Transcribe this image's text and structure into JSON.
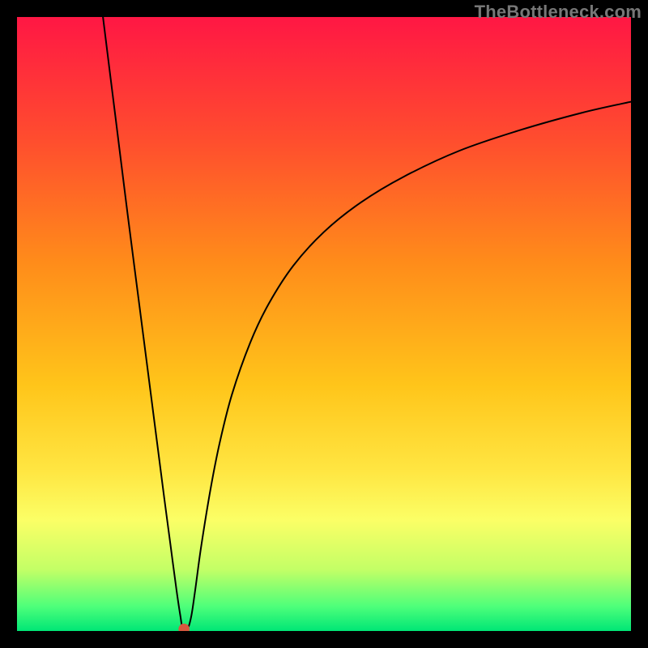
{
  "watermark": "TheBottleneck.com",
  "chart_data": {
    "type": "line",
    "title": "",
    "xlabel": "",
    "ylabel": "",
    "xlim": [
      0,
      100
    ],
    "ylim": [
      0,
      100
    ],
    "grid": false,
    "legend": false,
    "background_gradient_stops": [
      {
        "offset": 0.0,
        "color": "#ff1744"
      },
      {
        "offset": 0.2,
        "color": "#ff4d2e"
      },
      {
        "offset": 0.4,
        "color": "#ff8c1a"
      },
      {
        "offset": 0.6,
        "color": "#ffc51a"
      },
      {
        "offset": 0.74,
        "color": "#ffe642"
      },
      {
        "offset": 0.82,
        "color": "#fbff66"
      },
      {
        "offset": 0.9,
        "color": "#c3ff66"
      },
      {
        "offset": 0.96,
        "color": "#4eff7a"
      },
      {
        "offset": 1.0,
        "color": "#00e676"
      }
    ],
    "marker": {
      "x": 27.2,
      "y": 0.3,
      "color": "#d8583f",
      "radius": 0.9
    },
    "series": [
      {
        "name": "curve",
        "x": [
          14.0,
          16.0,
          18.0,
          20.0,
          22.0,
          24.0,
          25.0,
          26.0,
          26.6,
          27.0,
          27.8,
          28.4,
          29.0,
          30.0,
          31.5,
          33.0,
          35.0,
          38.0,
          41.0,
          45.0,
          50.0,
          56.0,
          63.0,
          72.0,
          82.0,
          92.0,
          100.0
        ],
        "y": [
          100.0,
          84.0,
          68.0,
          52.5,
          37.0,
          21.5,
          14.0,
          6.5,
          2.5,
          0.4,
          0.4,
          2.5,
          6.5,
          13.8,
          23.0,
          30.6,
          38.5,
          47.0,
          53.3,
          59.5,
          65.0,
          69.8,
          74.0,
          78.2,
          81.6,
          84.4,
          86.2
        ]
      }
    ]
  }
}
